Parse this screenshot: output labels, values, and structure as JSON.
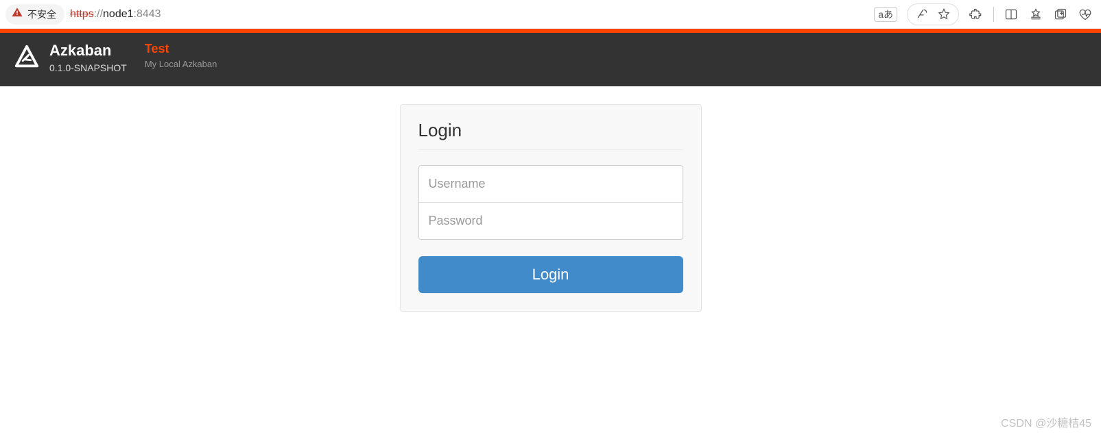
{
  "browser": {
    "security_label": "不安全",
    "url_protocol": "https",
    "url_separator": "://",
    "url_host": "node1",
    "url_port": ":8443",
    "lang_glyph": "aあ"
  },
  "header": {
    "brand_title": "Azkaban",
    "version": "0.1.0-SNAPSHOT",
    "env_label": "Test",
    "env_desc": "My Local Azkaban"
  },
  "login": {
    "title": "Login",
    "username_placeholder": "Username",
    "password_placeholder": "Password",
    "button_label": "Login"
  },
  "watermark": "CSDN @沙糖桔45",
  "colors": {
    "accent": "#ff4400",
    "header_bg": "#333333",
    "button": "#428bca"
  }
}
